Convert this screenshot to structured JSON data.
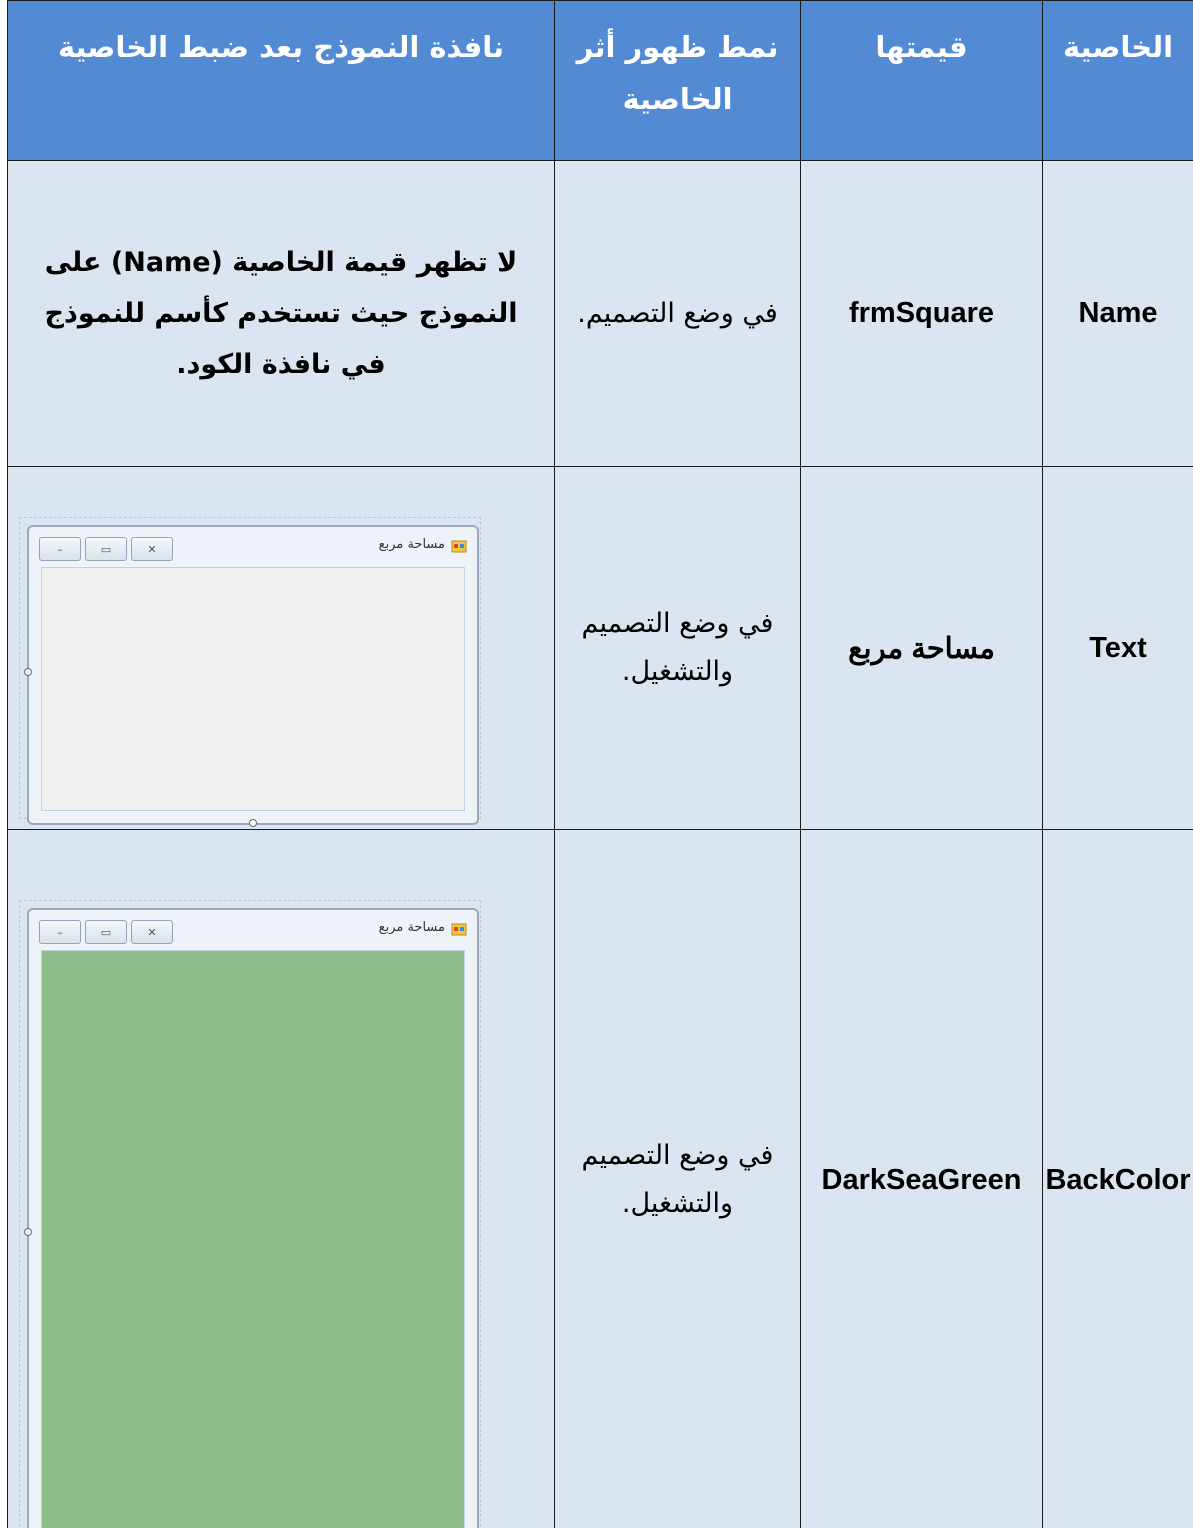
{
  "table": {
    "headers": [
      "الخاصية",
      "قيمتها",
      "نمط ظهور أثر الخاصية",
      "نافذة النموذج بعد ضبط الخاصية"
    ],
    "rows": [
      {
        "property": "Name",
        "value": "frmSquare",
        "mode": "في وضع التصميم.",
        "result": "لا تظهر قيمة الخاصية (Name) على النموذج حيث تستخدم كأسم للنموذج في نافذة الكود."
      },
      {
        "property": "Text",
        "value": "مساحة مربع",
        "mode": "في وضع التصميم والتشغيل.",
        "form": {
          "title": "مساحة مربع",
          "client_color": "#f0f0f0"
        }
      },
      {
        "property": "BackColor",
        "value": "DarkSeaGreen",
        "mode": "في وضع التصميم والتشغيل.",
        "form": {
          "title": "مساحة مربع",
          "client_color": "#8fbc8b"
        }
      }
    ]
  },
  "icons": {
    "minimize": "minimize-icon",
    "maximize": "maximize-icon",
    "close": "close-icon",
    "app": "form-app-icon"
  },
  "colors": {
    "header_bg": "#528bd4",
    "row_bg": "#dbe5f1",
    "border": "#1a1a1a"
  }
}
